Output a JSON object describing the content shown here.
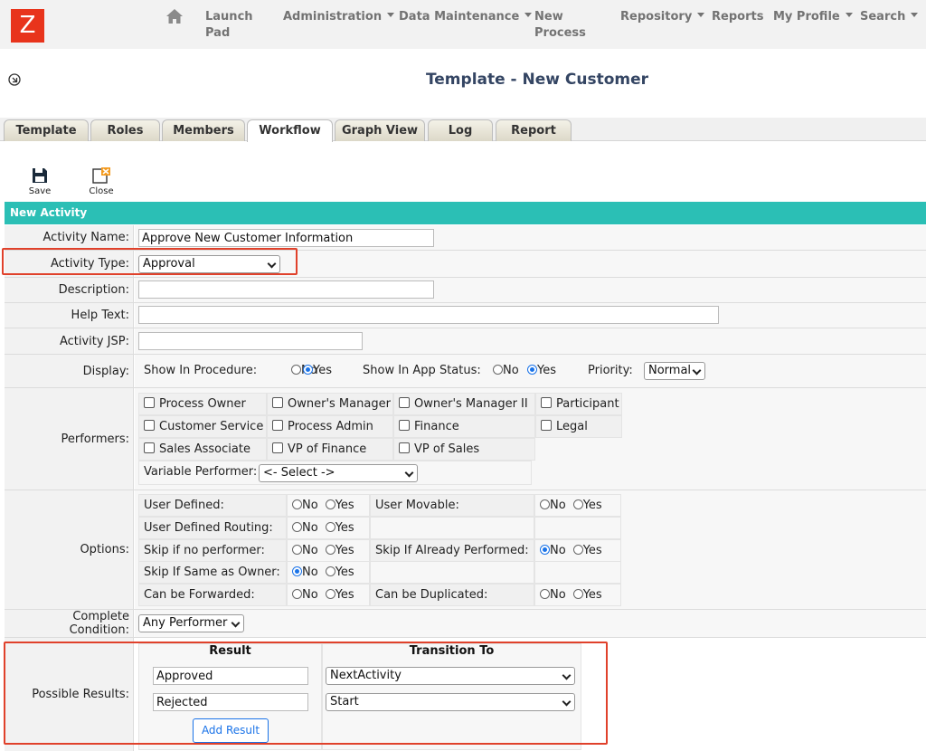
{
  "app": {
    "logo_letter": "Z"
  },
  "nav": {
    "items": [
      {
        "label": "Launch\nPad",
        "caret": false
      },
      {
        "label": "Administration",
        "caret": true
      },
      {
        "label": "Data Maintenance",
        "caret": true
      },
      {
        "label": "New\nProcess",
        "caret": false
      },
      {
        "label": "Repository",
        "caret": true
      },
      {
        "label": "Reports",
        "caret": false
      },
      {
        "label": "My Profile",
        "caret": true
      },
      {
        "label": "Search",
        "caret": true
      }
    ]
  },
  "header": {
    "title": "Template - New Customer"
  },
  "tabs": [
    {
      "label": "Template",
      "active": false
    },
    {
      "label": "Roles",
      "active": false
    },
    {
      "label": "Members",
      "active": false
    },
    {
      "label": "Workflow",
      "active": true
    },
    {
      "label": "Graph View",
      "active": false
    },
    {
      "label": "Log",
      "active": false
    },
    {
      "label": "Report",
      "active": false
    }
  ],
  "toolbar": {
    "save_label": "Save",
    "close_label": "Close"
  },
  "section": {
    "title": "New Activity"
  },
  "form": {
    "activity_name": {
      "label": "Activity Name:",
      "value": "Approve New Customer Information"
    },
    "activity_type": {
      "label": "Activity Type:",
      "value": "Approval"
    },
    "description": {
      "label": "Description:",
      "value": ""
    },
    "help_text": {
      "label": "Help Text:",
      "value": ""
    },
    "activity_jsp": {
      "label": "Activity JSP:",
      "value": ""
    },
    "display": {
      "label": "Display:",
      "show_in_procedure": "Show In Procedure:",
      "show_in_app_status": "Show In App Status:",
      "priority_label": "Priority:",
      "priority_value": "Normal",
      "no": "No",
      "yes": "Yes",
      "procedure_selected": "Yes",
      "app_status_selected": "Yes"
    },
    "performers": {
      "label": "Performers:",
      "options": [
        "Process Owner",
        "Owner's Manager",
        "Owner's Manager II",
        "Participant",
        "Customer Service",
        "Process Admin",
        "Finance",
        "Legal",
        "Sales Associate",
        "VP of Finance",
        "VP of Sales"
      ],
      "variable_label": "Variable Performer:",
      "variable_value": "<- Select ->"
    },
    "options": {
      "label": "Options:",
      "no": "No",
      "yes": "Yes",
      "items": [
        {
          "label": "User Defined:",
          "selected": ""
        },
        {
          "label": "User Movable:",
          "selected": ""
        },
        {
          "label": "User Defined Routing:",
          "selected": ""
        },
        {
          "label": "Skip if no performer:",
          "selected": ""
        },
        {
          "label": "Skip If Already Performed:",
          "selected": "No"
        },
        {
          "label": "Skip If Same as Owner:",
          "selected": "No"
        },
        {
          "label": "Can be Forwarded:",
          "selected": ""
        },
        {
          "label": "Can be Duplicated:",
          "selected": ""
        }
      ]
    },
    "complete_condition": {
      "label": "Complete Condition:",
      "value": "Any Performer"
    },
    "possible_results": {
      "label": "Possible Results:",
      "col_result": "Result",
      "col_transition": "Transition To",
      "rows": [
        {
          "result": "Approved",
          "transition": "NextActivity"
        },
        {
          "result": "Rejected",
          "transition": "Start"
        }
      ],
      "add_button": "Add Result"
    }
  },
  "colors": {
    "accent": "#2bbfb5",
    "logo": "#e8341c",
    "highlight": "#e0412b",
    "title": "#344563"
  }
}
